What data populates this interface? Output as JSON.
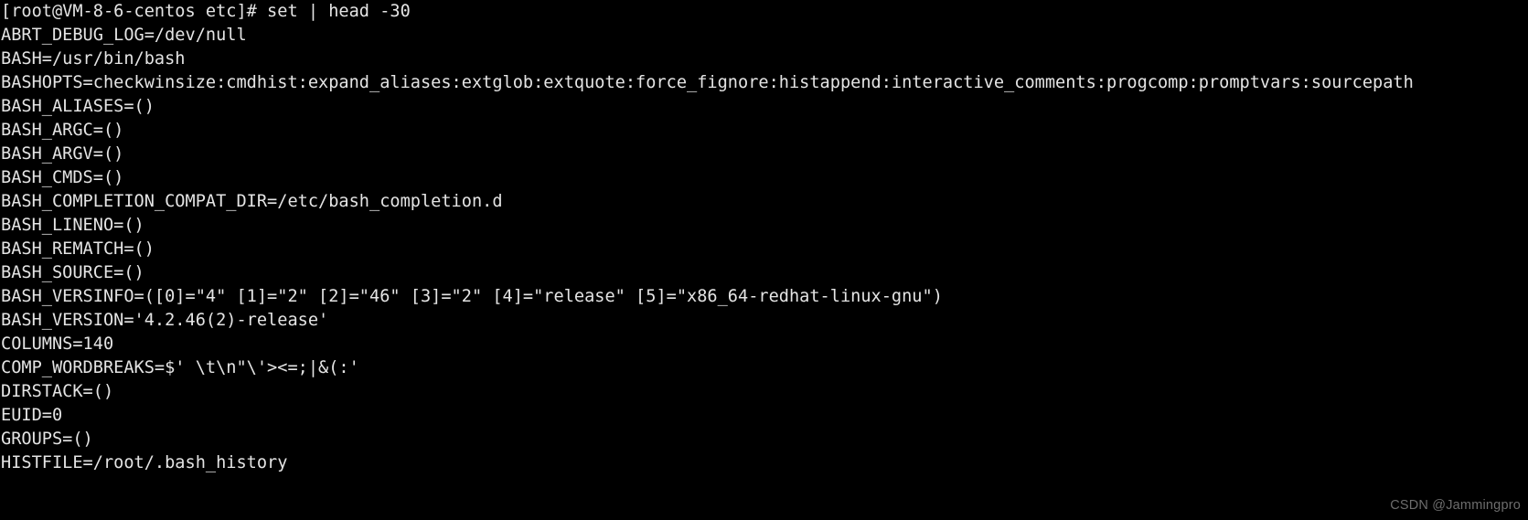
{
  "terminal": {
    "background_color": "#000000",
    "foreground_color": "#e4e4e4",
    "prompt": {
      "user": "root",
      "host": "VM-8-6-centos",
      "cwd": "etc",
      "symbol": "#",
      "full_prompt": "[root@VM-8-6-centos etc]#",
      "command": "set | head -30",
      "full_line": "[root@VM-8-6-centos etc]# set | head -30"
    },
    "lines": [
      "[root@VM-8-6-centos etc]# set | head -30",
      "ABRT_DEBUG_LOG=/dev/null",
      "BASH=/usr/bin/bash",
      "BASHOPTS=checkwinsize:cmdhist:expand_aliases:extglob:extquote:force_fignore:histappend:interactive_comments:progcomp:promptvars:sourcepath",
      "BASH_ALIASES=()",
      "BASH_ARGC=()",
      "BASH_ARGV=()",
      "BASH_CMDS=()",
      "BASH_COMPLETION_COMPAT_DIR=/etc/bash_completion.d",
      "BASH_LINENO=()",
      "BASH_REMATCH=()",
      "BASH_SOURCE=()",
      "BASH_VERSINFO=([0]=\"4\" [1]=\"2\" [2]=\"46\" [3]=\"2\" [4]=\"release\" [5]=\"x86_64-redhat-linux-gnu\")",
      "BASH_VERSION='4.2.46(2)-release'",
      "COLUMNS=140",
      "COMP_WORDBREAKS=$' \\t\\n\"\\'><=;|&(:'",
      "DIRSTACK=()",
      "EUID=0",
      "GROUPS=()",
      "HISTFILE=/root/.bash_history"
    ],
    "environment_variables": [
      {
        "name": "ABRT_DEBUG_LOG",
        "value": "/dev/null"
      },
      {
        "name": "BASH",
        "value": "/usr/bin/bash"
      },
      {
        "name": "BASHOPTS",
        "value": "checkwinsize:cmdhist:expand_aliases:extglob:extquote:force_fignore:histappend:interactive_comments:progcomp:promptvars:sourcepath"
      },
      {
        "name": "BASH_ALIASES",
        "value": "()"
      },
      {
        "name": "BASH_ARGC",
        "value": "()"
      },
      {
        "name": "BASH_ARGV",
        "value": "()"
      },
      {
        "name": "BASH_CMDS",
        "value": "()"
      },
      {
        "name": "BASH_COMPLETION_COMPAT_DIR",
        "value": "/etc/bash_completion.d"
      },
      {
        "name": "BASH_LINENO",
        "value": "()"
      },
      {
        "name": "BASH_REMATCH",
        "value": "()"
      },
      {
        "name": "BASH_SOURCE",
        "value": "()"
      },
      {
        "name": "BASH_VERSINFO",
        "value": "([0]=\"4\" [1]=\"2\" [2]=\"46\" [3]=\"2\" [4]=\"release\" [5]=\"x86_64-redhat-linux-gnu\")"
      },
      {
        "name": "BASH_VERSION",
        "value": "'4.2.46(2)-release'"
      },
      {
        "name": "COLUMNS",
        "value": "140"
      },
      {
        "name": "COMP_WORDBREAKS",
        "value": "$' \\t\\n\"\\'><=;|&(:'"
      },
      {
        "name": "DIRSTACK",
        "value": "()"
      },
      {
        "name": "EUID",
        "value": "0"
      },
      {
        "name": "GROUPS",
        "value": "()"
      },
      {
        "name": "HISTFILE",
        "value": "/root/.bash_history"
      }
    ]
  },
  "watermark": {
    "text": "CSDN @Jammingpro",
    "color": "#6d6d6d"
  }
}
